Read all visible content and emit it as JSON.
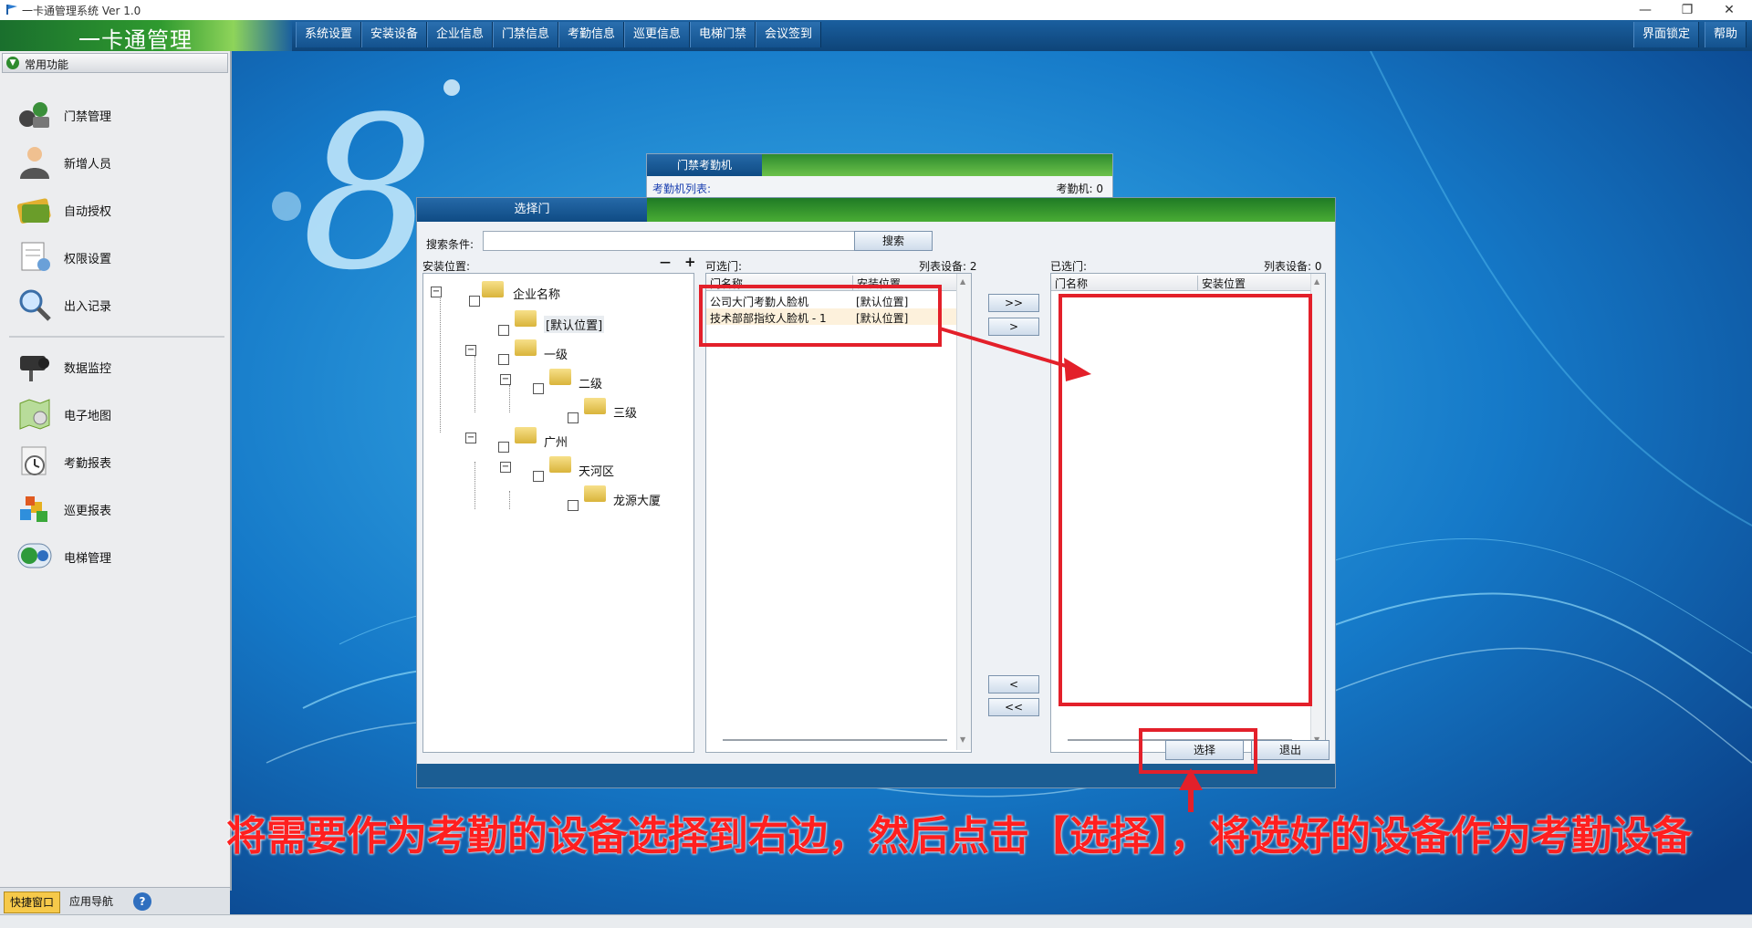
{
  "window": {
    "title": "一卡通管理系统 Ver 1.0",
    "minimize": "—",
    "restore": "❐",
    "close": "✕"
  },
  "app_title": "一卡通管理",
  "menu": {
    "items": [
      "系统设置",
      "安装设备",
      "企业信息",
      "门禁信息",
      "考勤信息",
      "巡更信息",
      "电梯门禁",
      "会议签到"
    ],
    "right": [
      "界面锁定",
      "帮助"
    ]
  },
  "sidebar": {
    "header": "常用功能",
    "items": [
      {
        "label": "门禁管理",
        "icon": "access-control-icon"
      },
      {
        "label": "新增人员",
        "icon": "person-icon"
      },
      {
        "label": "自动授权",
        "icon": "card-icon"
      },
      {
        "label": "权限设置",
        "icon": "document-icon"
      },
      {
        "label": "出入记录",
        "icon": "magnifier-icon"
      },
      {
        "label": "数据监控",
        "icon": "camera-icon"
      },
      {
        "label": "电子地图",
        "icon": "map-icon"
      },
      {
        "label": "考勤报表",
        "icon": "clock-icon"
      },
      {
        "label": "巡更报表",
        "icon": "blocks-icon"
      },
      {
        "label": "电梯管理",
        "icon": "elevator-icon"
      }
    ],
    "bottom_tabs": [
      "快捷窗口",
      "应用导航"
    ],
    "help_glyph": "?"
  },
  "back_dialog": {
    "tab": "门禁考勤机",
    "list_label": "考勤机列表:",
    "count_label": "考勤机: 0"
  },
  "dialog": {
    "title": "选择门",
    "search_label": "搜索条件:",
    "search_value": "",
    "search_button": "搜索",
    "location_label": "安装位置:",
    "collapse": "—",
    "expand": "+",
    "tree": [
      {
        "label": "企业名称"
      },
      {
        "label": "[默认位置]"
      },
      {
        "label": "一级"
      },
      {
        "label": "二级"
      },
      {
        "label": "三级"
      },
      {
        "label": "广州"
      },
      {
        "label": "天河区"
      },
      {
        "label": "龙源大厦"
      }
    ],
    "available_label": "可选门:",
    "available_count": "列表设备: 2",
    "available_columns": [
      "门名称",
      "安装位置"
    ],
    "available_rows": [
      {
        "name": "公司大门考勤人脸机",
        "location": "[默认位置]"
      },
      {
        "name": "技术部部指纹人脸机 - 1",
        "location": "[默认位置]"
      }
    ],
    "move_buttons": [
      ">>",
      ">",
      "<",
      "<<"
    ],
    "selected_label": "已选门:",
    "selected_count": "列表设备: 0",
    "selected_columns": [
      "门名称",
      "安装位置"
    ],
    "select_button": "选择",
    "exit_button": "退出"
  },
  "annotation": {
    "caption": "将需要作为考勤的设备选择到右边，然后点击【选择】，将选好的设备作为考勤设备",
    "color": "#e3202a"
  },
  "decor": {
    "big_numeral": "8"
  }
}
